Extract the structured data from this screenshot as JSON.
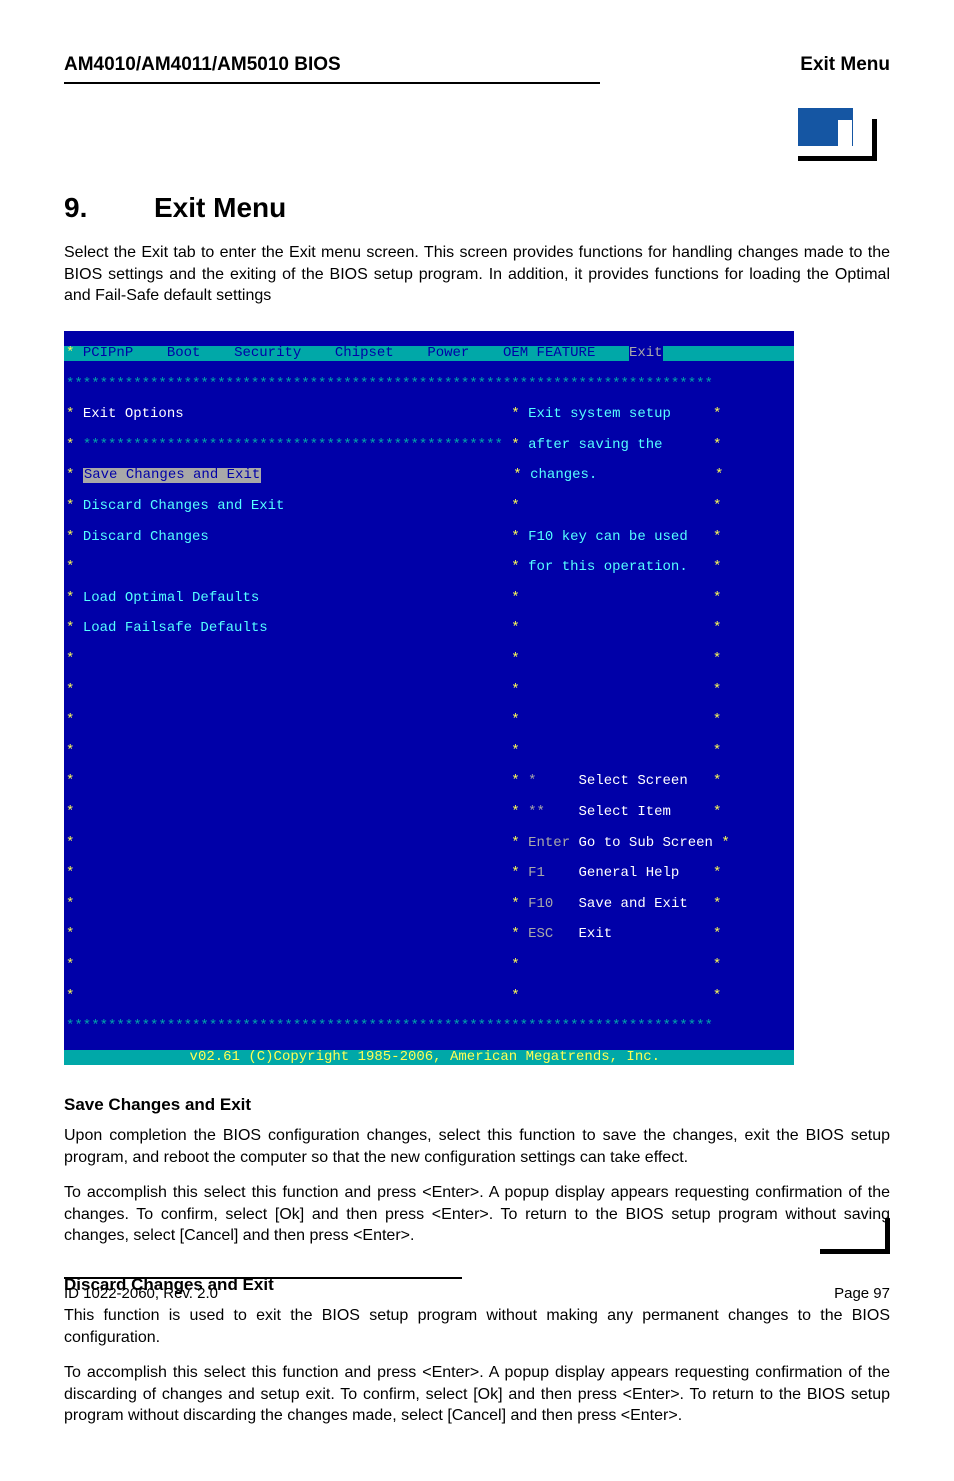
{
  "header": {
    "left": "AM4010/AM4011/AM5010 BIOS",
    "right": "Exit Menu"
  },
  "section": {
    "num": "9.",
    "title": "Exit Menu"
  },
  "intro": "Select the Exit tab to enter the Exit menu screen. This screen provides functions for handling changes made to the BIOS settings and the exiting of the BIOS setup program. In addition, it provides functions for loading the Optimal and Fail-Safe default settings",
  "bios": {
    "tabs": [
      "PCIPnP",
      "Boot",
      "Security",
      "Chipset",
      "Power",
      "OEM FEATURE",
      "Exit"
    ],
    "left": {
      "heading": "Exit Options",
      "items": [
        "Save Changes and Exit",
        "Discard Changes and Exit",
        "Discard Changes",
        "",
        "Load Optimal Defaults",
        "Load Failsafe Defaults"
      ]
    },
    "help": {
      "lines": [
        "Exit system setup",
        "after saving the",
        "changes.",
        "",
        "F10 key can be used",
        "for this operation."
      ]
    },
    "keys": [
      {
        "k": "*",
        "v": "Select Screen"
      },
      {
        "k": "**",
        "v": "Select Item"
      },
      {
        "k": "Enter",
        "v": "Go to Sub Screen"
      },
      {
        "k": "F1",
        "v": "General Help"
      },
      {
        "k": "F10",
        "v": "Save and Exit"
      },
      {
        "k": "ESC",
        "v": "Exit"
      }
    ],
    "footer": "v02.61 (C)Copyright 1985-2006, American Megatrends, Inc."
  },
  "sec1": {
    "title": "Save Changes and Exit",
    "p1": "Upon completion the BIOS configuration changes, select this function to save the changes, exit the BIOS setup program, and reboot the computer so that the new configuration settings can take effect.",
    "p2": "To accomplish this select this function and press <Enter>. A popup display appears requesting confirmation of the changes. To confirm, select [Ok] and then press <Enter>. To return to the BIOS setup program without saving changes, select [Cancel] and then press <Enter>."
  },
  "sec2": {
    "title": "Discard Changes and Exit",
    "p1": "This function is used to exit the BIOS setup program without making any permanent changes to the BIOS configuration.",
    "p2": "To accomplish this select this function and press <Enter>. A popup display appears requesting confirmation of the discarding of changes and setup exit. To confirm, select [Ok] and then press <Enter>. To return to the BIOS setup program without discarding the changes made, select [Cancel] and then press <Enter>."
  },
  "footer": {
    "left": "ID 1022-2060, Rev. 2.0",
    "right": "Page 97"
  }
}
